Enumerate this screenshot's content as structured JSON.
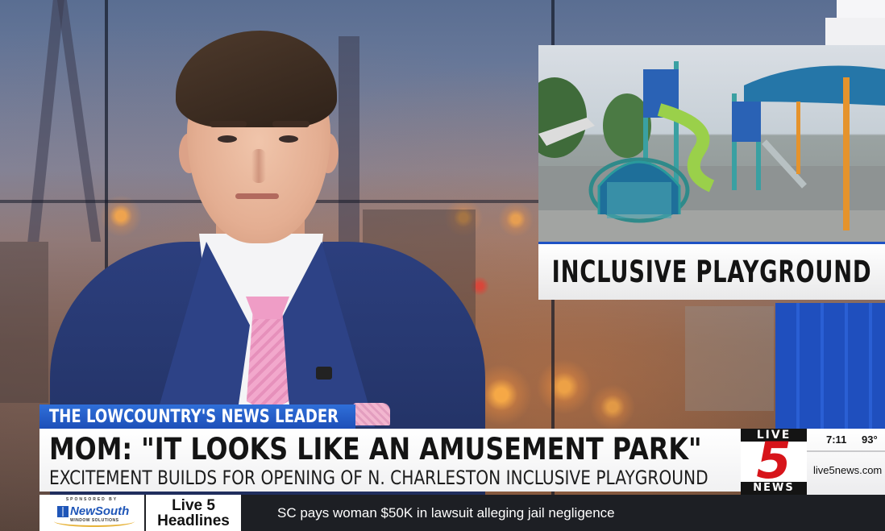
{
  "broadcast": {
    "ots_graphic": {
      "label": "INCLUSIVE PLAYGROUND"
    },
    "tagline": "THE LOWCOUNTRY'S NEWS LEADER",
    "headline": "MOM: \"IT LOOKS LIKE AN AMUSEMENT PARK\"",
    "subheadline": "EXCITEMENT BUILDS FOR OPENING OF N. CHARLESTON INCLUSIVE PLAYGROUND",
    "logo": {
      "top": "LIVE",
      "number": "5",
      "bottom": "NEWS"
    },
    "info": {
      "time": "7:11",
      "temperature": "93°",
      "website": "live5news.com"
    }
  },
  "ticker": {
    "sponsor_top": "SPONSORED BY",
    "sponsor_name": "NewSouth",
    "sponsor_sub": "WINDOW SOLUTIONS",
    "label_line1": "Live 5",
    "label_line2": "Headlines",
    "text": "SC pays woman $50K in lawsuit alleging jail negligence"
  },
  "colors": {
    "accent_blue": "#1f52c4",
    "brand_red": "#d7141a",
    "tie_pink": "#ef9dc6",
    "suit_navy": "#2c3f7e"
  },
  "icons": [
    "live5-logo",
    "newsouth-logo-icon"
  ]
}
